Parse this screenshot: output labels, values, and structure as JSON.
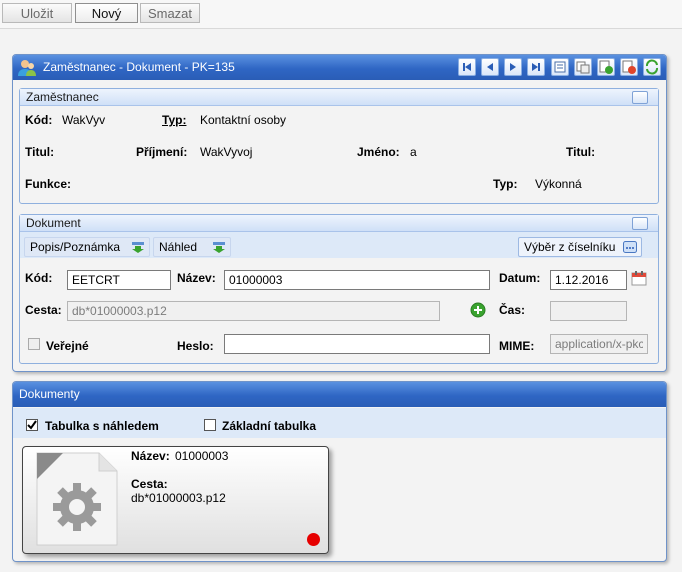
{
  "toolbar": {
    "save_label": "Uložit",
    "new_label": "Nový",
    "delete_label": "Smazat"
  },
  "main_panel": {
    "title": "Zaměstnanec - Dokument - PK=135"
  },
  "employee": {
    "section_title": "Zaměstnanec",
    "code_label": "Kód:",
    "code_value": "WakVyv",
    "type_label": "Typ:",
    "type_value": "Kontaktní osoby",
    "title_label": "Titul:",
    "surname_label": "Příjmení:",
    "surname_value": "WakVyvoj",
    "name_label": "Jméno:",
    "name_value": "a",
    "title2_label": "Titul:",
    "function_label": "Funkce:",
    "type2_label": "Typ:",
    "type2_value": "Výkonná"
  },
  "document": {
    "section_title": "Dokument",
    "tab_note": "Popis/Poznámka",
    "tab_preview": "Náhled",
    "select_button": "Výběr z číselníku",
    "code_label": "Kód:",
    "code_value": "EETCRT",
    "name_label": "Název:",
    "name_value": "01000003",
    "date_label": "Datum:",
    "date_value": "1.12.2016",
    "path_label": "Cesta:",
    "path_value": "db*01000003.p12",
    "time_label": "Čas:",
    "time_value": "",
    "public_label": "Veřejné",
    "password_label": "Heslo:",
    "password_value": "",
    "mime_label": "MIME:",
    "mime_value": "application/x-pkc"
  },
  "documents_panel": {
    "title": "Dokumenty",
    "opt_preview": "Tabulka s náhledem",
    "opt_basic": "Základní tabulka",
    "card": {
      "name_label": "Název:",
      "name_value": "01000003",
      "path_label": "Cesta:",
      "path_value": "db*01000003.p12"
    }
  },
  "colors": {
    "header_blue": "#2f66c4",
    "status_dot": "#e60000",
    "add_green": "#3aa32f"
  }
}
